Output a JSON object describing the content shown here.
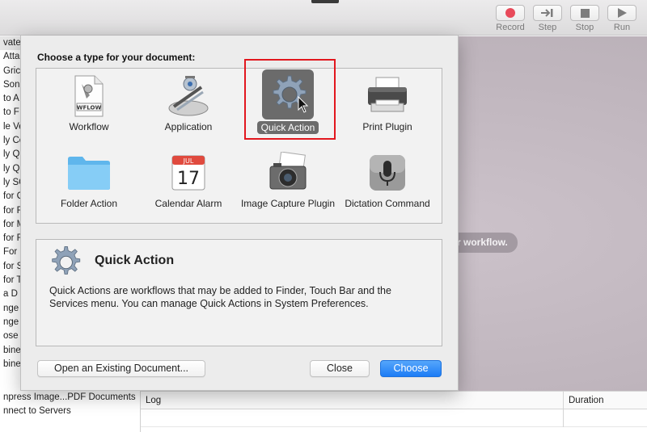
{
  "toolbar": {
    "record_label": "Record",
    "step_label": "Step",
    "stop_label": "Stop",
    "run_label": "Run"
  },
  "background": {
    "hint_text": "r workflow.",
    "sidebar_rows": [
      "vate",
      "Atta",
      "Gric",
      "Son",
      "to A",
      "to F",
      "le Ve",
      "ly Co",
      "ly Q",
      "ly Q",
      "ly SC",
      "for C",
      "for F",
      "for M",
      "for F",
      "For",
      "for S",
      "for T",
      "a D",
      "nge",
      "nge",
      "ose",
      "bine",
      "bine"
    ],
    "bottom_rows": [
      "npress Image...PDF Documents",
      "nnect to Servers"
    ],
    "log": {
      "col_log": "Log",
      "col_duration": "Duration"
    }
  },
  "sheet": {
    "title": "Choose a type for your document:",
    "types": [
      {
        "label": "Workflow",
        "icon": "workflow-document-icon",
        "sub": "WFLOW"
      },
      {
        "label": "Application",
        "icon": "application-robot-icon"
      },
      {
        "label": "Quick Action",
        "icon": "gear-icon",
        "selected": true
      },
      {
        "label": "Print Plugin",
        "icon": "printer-icon"
      },
      {
        "label": "Folder Action",
        "icon": "folder-icon"
      },
      {
        "label": "Calendar Alarm",
        "icon": "calendar-icon",
        "month": "JUL",
        "day": "17"
      },
      {
        "label": "Image Capture Plugin",
        "icon": "camera-icon"
      },
      {
        "label": "Dictation Command",
        "icon": "microphone-icon"
      }
    ],
    "description": {
      "title": "Quick Action",
      "text": "Quick Actions are workflows that may be added to Finder, Touch Bar and the Services menu. You can manage Quick Actions in System Preferences."
    },
    "buttons": {
      "open_existing": "Open an Existing Document...",
      "close": "Close",
      "choose": "Choose"
    }
  },
  "colors": {
    "accent_blue": "#1c7cf5",
    "highlight_red": "#e2171e",
    "record_red": "#e84a5a"
  }
}
